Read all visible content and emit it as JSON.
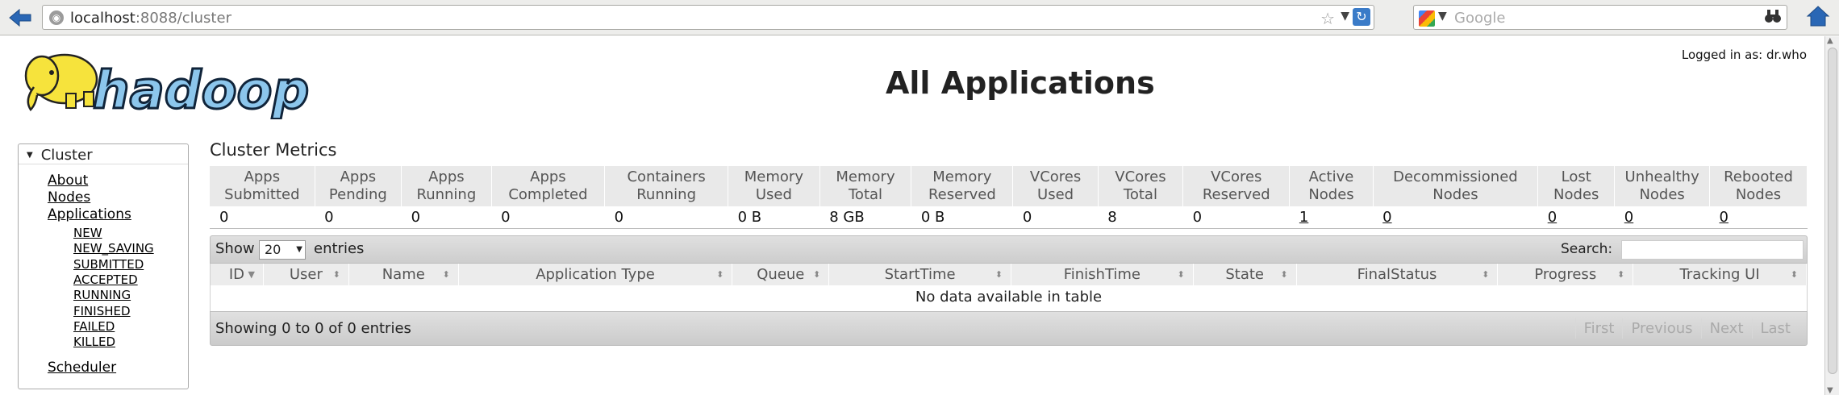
{
  "browser": {
    "url_host": "localhost",
    "url_rest": ":8088/cluster",
    "search_placeholder": "Google"
  },
  "header": {
    "logo_text": "hadoop",
    "login_info": "Logged in as: dr.who",
    "title": "All Applications"
  },
  "sidebar": {
    "section": "Cluster",
    "links": [
      "About",
      "Nodes",
      "Applications"
    ],
    "app_states": [
      "NEW",
      "NEW_SAVING",
      "SUBMITTED",
      "ACCEPTED",
      "RUNNING",
      "FINISHED",
      "FAILED",
      "KILLED"
    ],
    "scheduler": "Scheduler"
  },
  "metrics": {
    "title": "Cluster Metrics",
    "headers": [
      [
        "Apps",
        "Submitted"
      ],
      [
        "Apps",
        "Pending"
      ],
      [
        "Apps",
        "Running"
      ],
      [
        "Apps",
        "Completed"
      ],
      [
        "Containers",
        "Running"
      ],
      [
        "Memory",
        "Used"
      ],
      [
        "Memory",
        "Total"
      ],
      [
        "Memory",
        "Reserved"
      ],
      [
        "VCores",
        "Used"
      ],
      [
        "VCores",
        "Total"
      ],
      [
        "VCores",
        "Reserved"
      ],
      [
        "Active",
        "Nodes"
      ],
      [
        "Decommissioned",
        "Nodes"
      ],
      [
        "Lost",
        "Nodes"
      ],
      [
        "Unhealthy",
        "Nodes"
      ],
      [
        "Rebooted",
        "Nodes"
      ]
    ],
    "values": [
      "0",
      "0",
      "0",
      "0",
      "0",
      "0 B",
      "8 GB",
      "0 B",
      "0",
      "8",
      "0",
      "1",
      "0",
      "0",
      "0",
      "0"
    ],
    "linked": [
      false,
      false,
      false,
      false,
      false,
      false,
      false,
      false,
      false,
      false,
      false,
      true,
      true,
      true,
      true,
      true
    ]
  },
  "apps_table": {
    "show_label": "Show",
    "length_value": "20",
    "entries_label": "entries",
    "search_label": "Search:",
    "columns": [
      "ID",
      "User",
      "Name",
      "Application Type",
      "Queue",
      "StartTime",
      "FinishTime",
      "State",
      "FinalStatus",
      "Progress",
      "Tracking UI"
    ],
    "empty_message": "No data available in table",
    "info": "Showing 0 to 0 of 0 entries",
    "pagination": [
      "First",
      "Previous",
      "Next",
      "Last"
    ]
  }
}
